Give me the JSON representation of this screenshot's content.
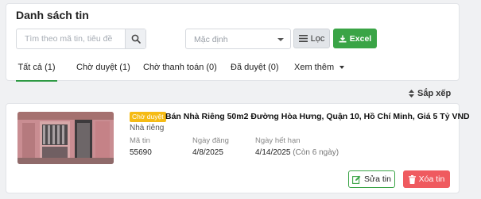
{
  "header": {
    "title": "Danh sách tin"
  },
  "search": {
    "placeholder": "Tìm theo mã tin, tiêu đề",
    "value": "",
    "icon": "search-icon"
  },
  "sort_select": {
    "value": "Mặc định",
    "icon": "chevron-down-icon"
  },
  "toolbar": {
    "filter_label": "Lọc",
    "filter_icon": "filter-lines-icon",
    "excel_label": "Excel",
    "excel_icon": "download-icon",
    "excel_color": "#3aa446"
  },
  "tabs": [
    {
      "label": "Tất cả (1)",
      "active": true
    },
    {
      "label": "Chờ duyệt (1)",
      "active": false
    },
    {
      "label": "Chờ thanh toán (0)",
      "active": false
    },
    {
      "label": "Đã duyệt (0)",
      "active": false
    },
    {
      "label": "Xem thêm",
      "active": false,
      "icon": "caret-down-icon"
    }
  ],
  "sort": {
    "label": "Sắp xếp",
    "icon": "sort-icon"
  },
  "listing": {
    "status": "Chờ duyệt",
    "status_color": "#f5bb15",
    "title": "Bán Nhà Riêng 50m2 Đường Hòa Hưng, Quận 10, Hồ Chí Minh, Giá 5 Tỷ VND",
    "type": "Nhà riêng",
    "fields": {
      "id": {
        "label": "Mã tin",
        "value": "55690"
      },
      "posted": {
        "label": "Ngày đăng",
        "value": "4/8/2025"
      },
      "expiry": {
        "label": "Ngày hết hạn",
        "value": "4/14/2025",
        "extra": "(Còn 6 ngày)"
      }
    },
    "edit_label": "Sửa tin",
    "edit_icon": "edit-icon",
    "delete_label": "Xóa tin",
    "delete_icon": "trash-icon",
    "delete_color": "#ef5a5f"
  }
}
